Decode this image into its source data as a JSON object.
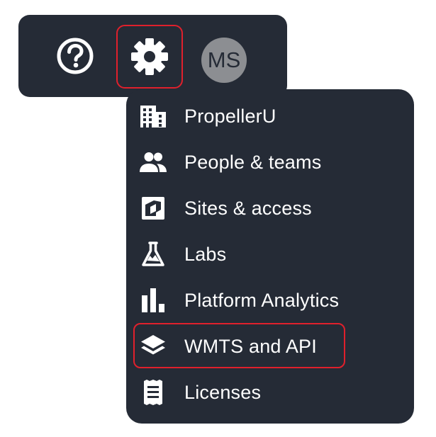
{
  "toolbar": {
    "help_icon": "help-circle-icon",
    "settings_icon": "gear-icon",
    "avatar_initials": "MS"
  },
  "menu": {
    "items": [
      {
        "label": "PropellerU",
        "icon": "building-icon"
      },
      {
        "label": "People & teams",
        "icon": "people-icon"
      },
      {
        "label": "Sites & access",
        "icon": "map-icon"
      },
      {
        "label": "Labs",
        "icon": "flask-icon"
      },
      {
        "label": "Platform Analytics",
        "icon": "bar-chart-icon"
      },
      {
        "label": "WMTS and API",
        "icon": "layers-icon"
      },
      {
        "label": "Licenses",
        "icon": "receipt-icon"
      }
    ]
  },
  "colors": {
    "panel_bg": "#252b36",
    "highlight": "#e0202c",
    "text": "#ffffff",
    "avatar_bg": "#8c8e92"
  }
}
